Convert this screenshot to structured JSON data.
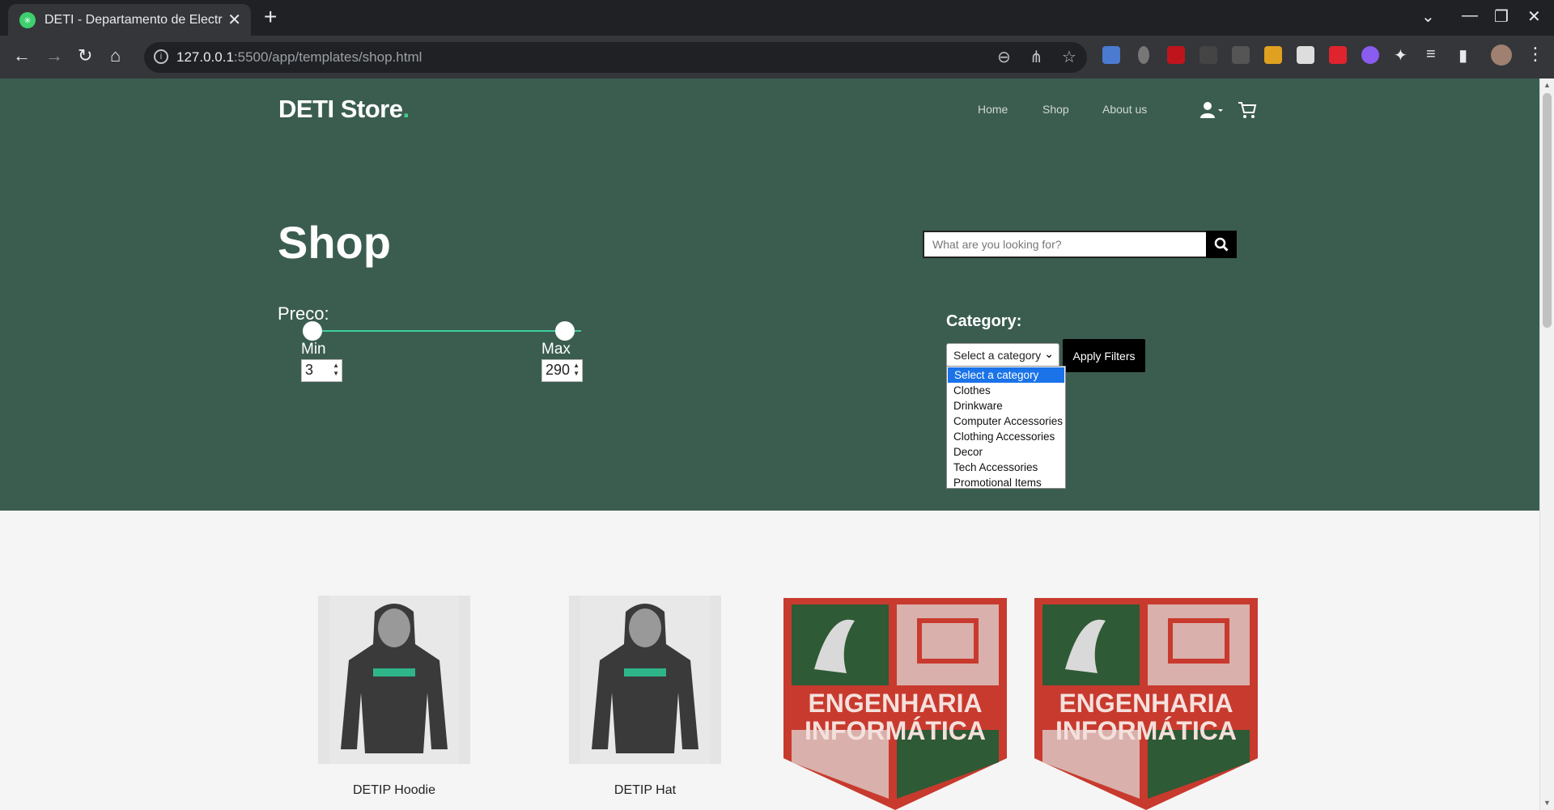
{
  "browser": {
    "tab_title": "DETI - Departamento de Electrónica",
    "tab_close": "✕",
    "new_tab": "+",
    "url_host": "127.0.0.1",
    "url_rest": ":5500/app/templates/shop.html",
    "window_controls": [
      "⌄",
      "—",
      "❐",
      "✕"
    ]
  },
  "site": {
    "brand": "DETI Store",
    "brand_dot": ".",
    "nav": [
      "Home",
      "Shop",
      "About us"
    ]
  },
  "hero": {
    "title": "Shop",
    "search_placeholder": "What are you looking for?"
  },
  "price_filter": {
    "label": "Preco:",
    "min_label": "Min",
    "max_label": "Max",
    "min_value": "3",
    "max_value": "290"
  },
  "category_filter": {
    "label": "Category:",
    "selected": "Select a category",
    "apply_label": "Apply Filters",
    "options": [
      "Select a category",
      "Clothes",
      "Drinkware",
      "Computer Accessories",
      "Clothing Accessories",
      "Decor",
      "Tech Accessories",
      "Promotional Items"
    ]
  },
  "products": [
    {
      "name": "DETIP Hoodie"
    },
    {
      "name": "DETIP Hat"
    },
    {
      "name": ""
    },
    {
      "name": ""
    }
  ],
  "badge_text": [
    "ENGENHARIA",
    "INFORMÁTICA"
  ],
  "colors": {
    "hero_bg": "#3b5d50",
    "accent": "#3ecf8e",
    "page_bg": "#f5f5f5"
  }
}
